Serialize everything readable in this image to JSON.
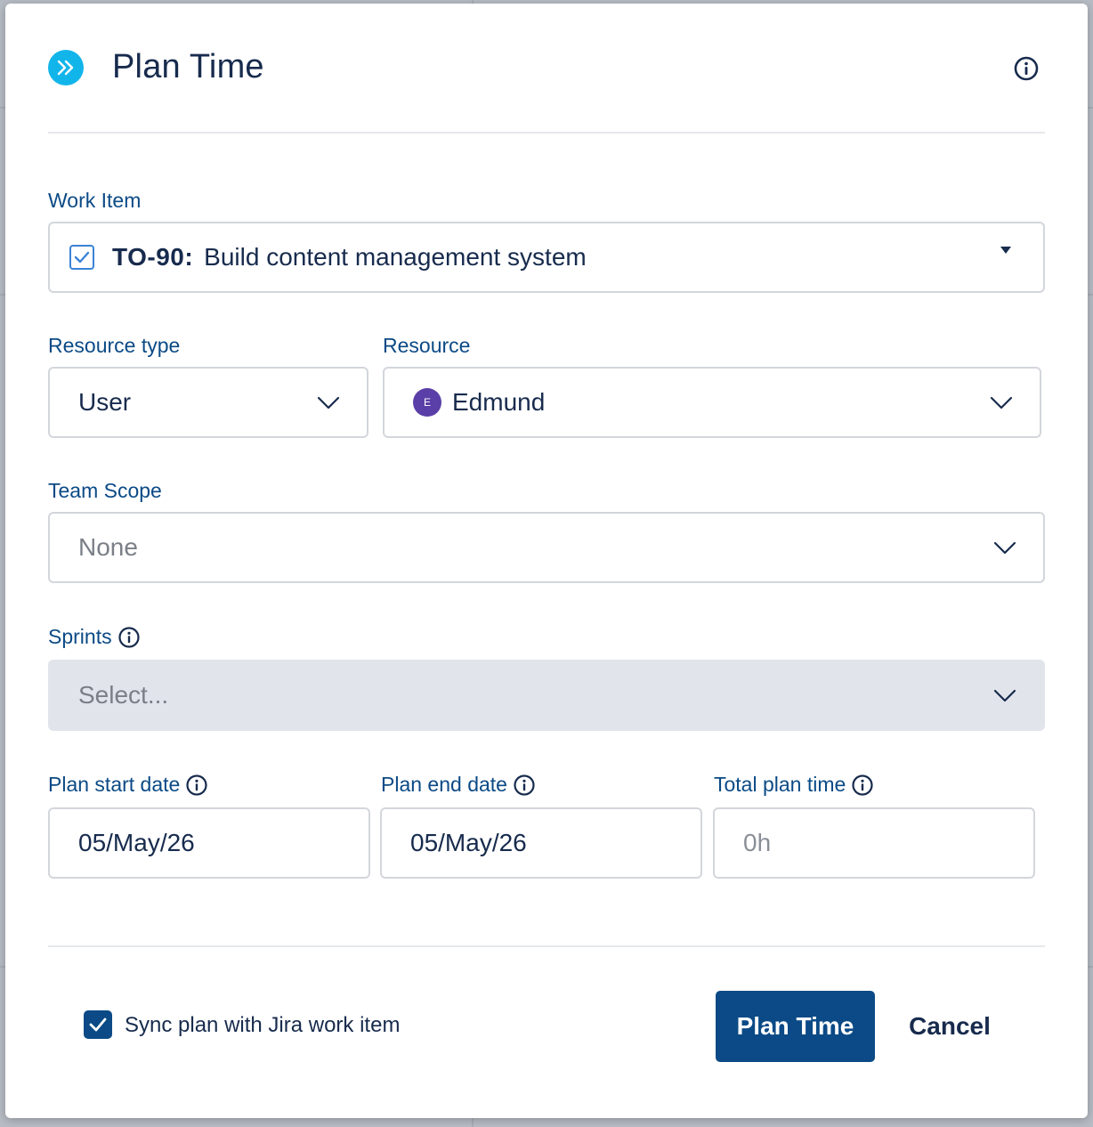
{
  "dialog": {
    "title": "Plan Time"
  },
  "work_item": {
    "label": "Work Item",
    "key": "TO-90:",
    "summary": "Build content management system"
  },
  "resource_type": {
    "label": "Resource type",
    "value": "User"
  },
  "resource": {
    "label": "Resource",
    "avatar_initial": "E",
    "value": "Edmund"
  },
  "team_scope": {
    "label": "Team Scope",
    "value": "None"
  },
  "sprints": {
    "label": "Sprints",
    "placeholder": "Select..."
  },
  "plan_start_date": {
    "label": "Plan start date",
    "value": "05/May/26"
  },
  "plan_end_date": {
    "label": "Plan end date",
    "value": "05/May/26"
  },
  "total_plan_time": {
    "label": "Total plan time",
    "placeholder": "0h"
  },
  "footer": {
    "sync_label": "Sync plan with Jira work item",
    "sync_checked": true,
    "primary_label": "Plan Time",
    "cancel_label": "Cancel"
  },
  "colors": {
    "accent": "#0b4a86",
    "logo": "#12b5ea",
    "avatar": "#5b3fa8",
    "label": "#0b4a86",
    "disabled_field": "#e2e4ec"
  },
  "icons": {
    "logo": "double-chevron-right-icon",
    "info": "info-circle-icon",
    "dropdown": "chevron-down-icon",
    "work_item_type": "checkbox-task-icon",
    "check": "checkmark-icon"
  }
}
